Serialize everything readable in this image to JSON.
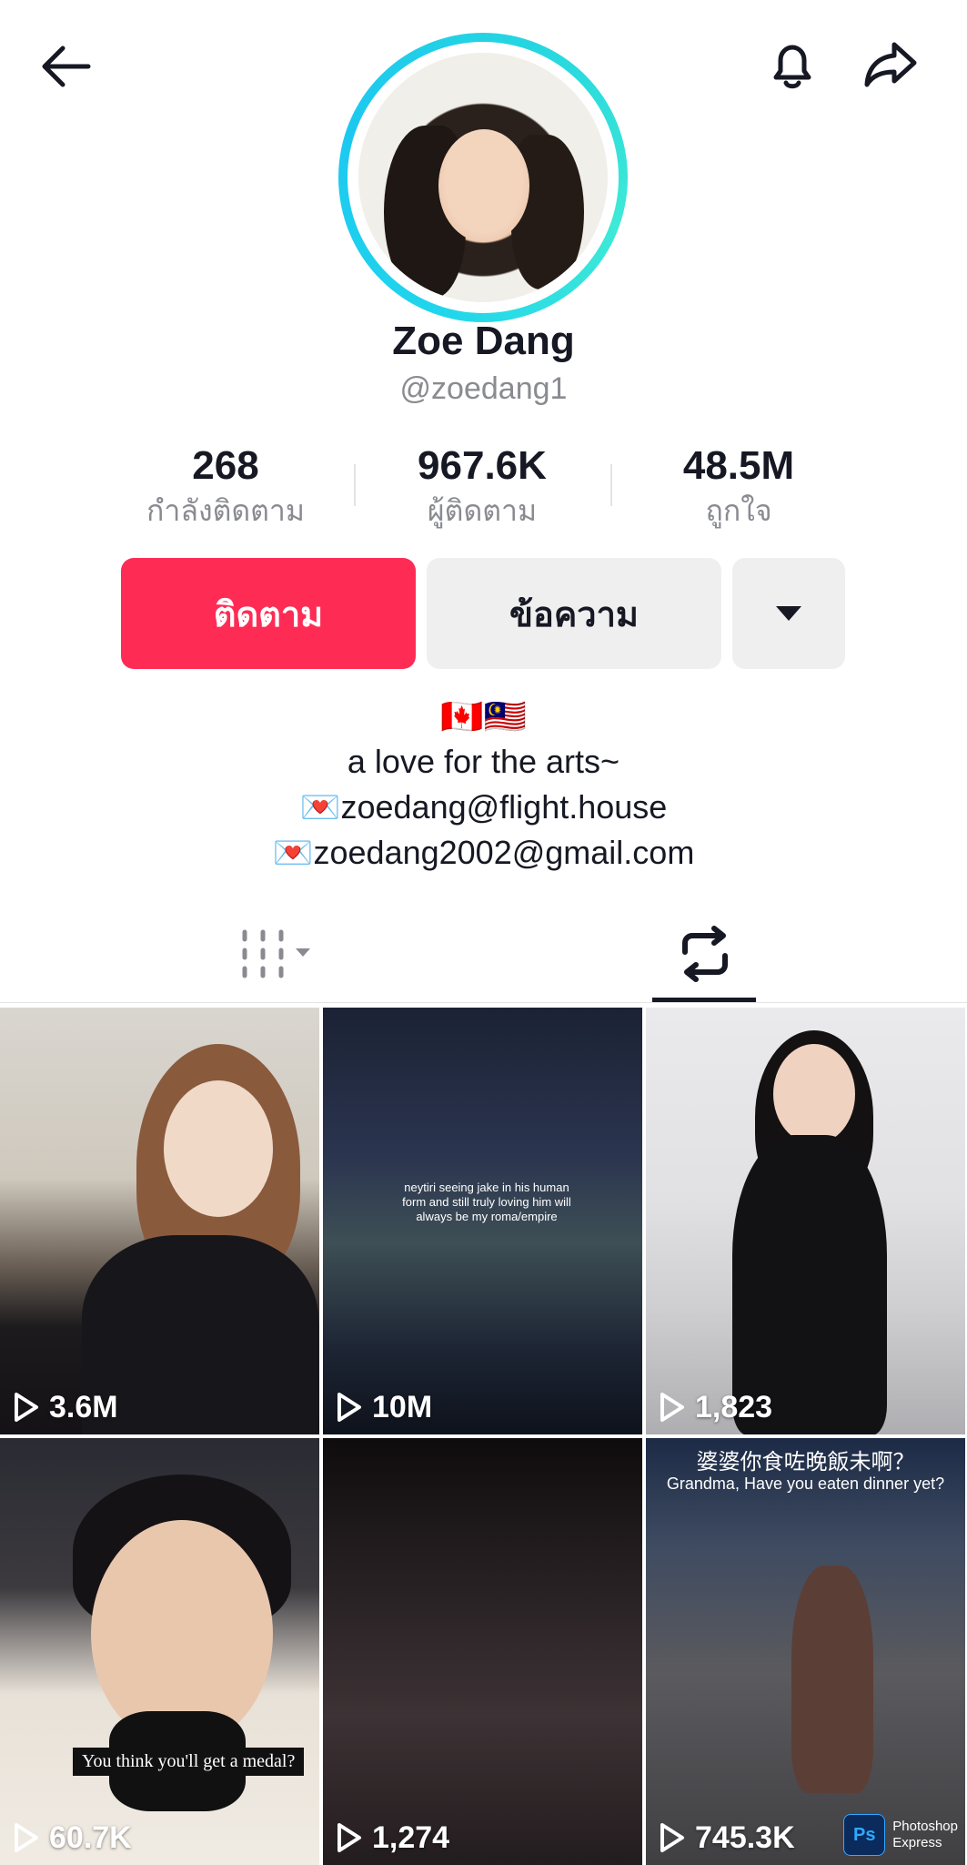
{
  "icons": {
    "back": "arrow-left-icon",
    "bell": "bell-icon",
    "share": "share-arrow-icon",
    "more": "caret-down-icon",
    "tab_videos": "grid-icon",
    "tab_reposts": "repost-icon",
    "views": "play-icon"
  },
  "profile": {
    "name": "Zoe Dang",
    "handle": "@zoedang1"
  },
  "stats": {
    "following": {
      "value": "268",
      "label": "กำลังติดตาม"
    },
    "followers": {
      "value": "967.6K",
      "label": "ผู้ติดตาม"
    },
    "likes": {
      "value": "48.5M",
      "label": "ถูกใจ"
    }
  },
  "actions": {
    "follow": "ติดตาม",
    "message": "ข้อความ"
  },
  "bio": {
    "flags": "🇨🇦🇲🇾",
    "line1": "a love for the arts~",
    "line2": "💌zoedang@flight.house",
    "line3": "💌zoedang2002@gmail.com"
  },
  "colors": {
    "accent": "#fe2c55",
    "avatar_ring": "#20d5ec",
    "secondary_button": "#efeff0"
  },
  "videos": [
    {
      "views": "3.6M"
    },
    {
      "views": "10M",
      "caption": "neytiri seeing jake in his human form and still truly loving him will always be my roma/empire"
    },
    {
      "views": "1,823"
    },
    {
      "views": "60.7K",
      "caption": "You think you'll get a medal?"
    },
    {
      "views": "1,274"
    },
    {
      "views": "745.3K",
      "caption_top": "婆婆你食咗晚飯未啊？",
      "caption_sub": "Grandma, Have you eaten dinner yet?",
      "watermark_line1": "Photoshop",
      "watermark_line2": "Express",
      "watermark_logo": "Ps"
    }
  ]
}
